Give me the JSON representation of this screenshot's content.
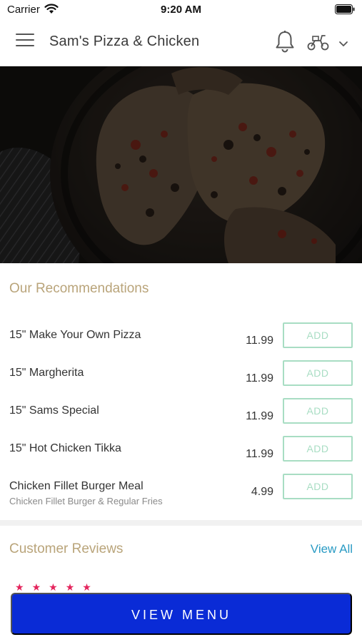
{
  "status_bar": {
    "carrier": "Carrier",
    "time": "9:20 AM"
  },
  "header": {
    "title": "Sam's Pizza & Chicken",
    "icons": [
      "hamburger-menu-icon",
      "bell-icon",
      "scooter-icon",
      "chevron-down-icon"
    ]
  },
  "recommendations": {
    "title": "Our Recommendations",
    "add_label": "ADD",
    "items": [
      {
        "name": "15\" Make Your Own Pizza",
        "desc": "",
        "price": "11.99"
      },
      {
        "name": "15\" Margherita",
        "desc": "",
        "price": "11.99"
      },
      {
        "name": "15\" Sams Special",
        "desc": "",
        "price": "11.99"
      },
      {
        "name": "15\" Hot Chicken Tikka",
        "desc": "",
        "price": "11.99"
      },
      {
        "name": "Chicken Fillet Burger Meal",
        "desc": "Chicken Fillet Burger & Regular Fries",
        "price": "4.99"
      }
    ]
  },
  "reviews": {
    "title": "Customer Reviews",
    "view_all": "View All",
    "star_rating": 5
  },
  "cta": {
    "label": "VIEW MENU"
  },
  "colors": {
    "accent_gold": "#b9a47a",
    "add_green": "#a8ddc3",
    "link_blue": "#2a9bc4",
    "cta_blue": "#0a2bd6",
    "star_pink": "#e4245c"
  }
}
